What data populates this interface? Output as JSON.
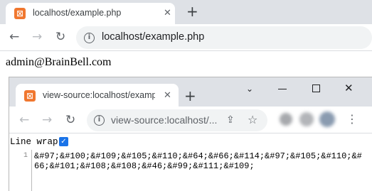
{
  "outer_browser": {
    "tab": {
      "title": "localhost/example.php",
      "favicon": "xampp-icon",
      "close": "✕"
    },
    "new_tab": "+",
    "toolbar": {
      "back": "←",
      "forward": "→",
      "reload": "↻"
    },
    "omnibox": {
      "info": "i",
      "url": "localhost/example.php"
    }
  },
  "page": {
    "text": "admin@BrainBell.com"
  },
  "view_source_window": {
    "tab": {
      "title": "view-source:localhost/example.php",
      "favicon": "xampp-icon",
      "close": "✕"
    },
    "new_tab": "+",
    "window_controls": {
      "chevron": "⌄",
      "close": "✕"
    },
    "toolbar": {
      "back": "←",
      "forward": "→",
      "reload": "↻",
      "share": "⇪",
      "star": "☆",
      "menu": "⋮"
    },
    "omnibox": {
      "info": "i",
      "url": "view-source:localhost/..."
    },
    "line_wrap": {
      "label": "Line wrap",
      "checked": true,
      "check": "✓"
    },
    "source": {
      "line_number": "1",
      "code": "&#97;&#100;&#109;&#105;&#110;&#64;&#66;&#114;&#97;&#105;&#110;&#66;&#101;&#108;&#108;&#46;&#99;&#111;&#109;"
    }
  },
  "colors": {
    "tab_strip": "#dee1e6",
    "favicon": "#f0772f",
    "checkbox": "#1a73e8"
  }
}
